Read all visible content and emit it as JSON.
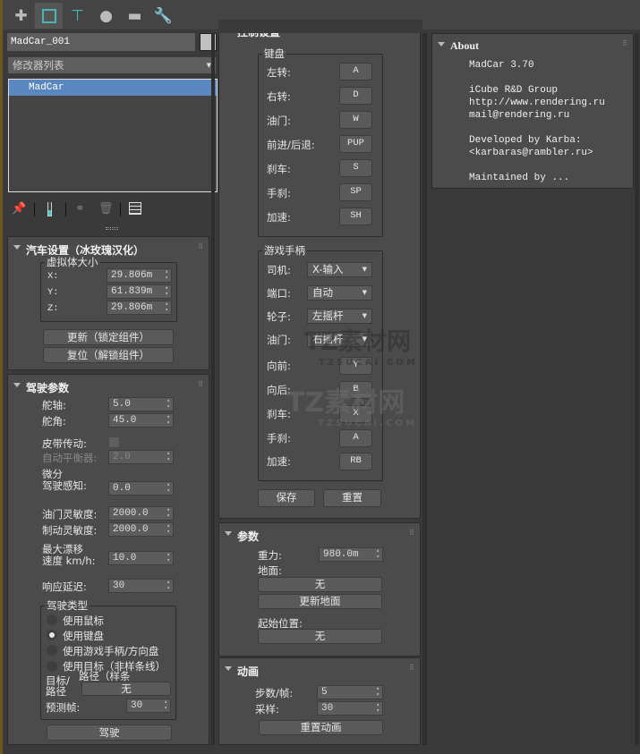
{
  "toolbar": {
    "tabs": [
      {
        "name": "create",
        "icon": "plus-icon"
      },
      {
        "name": "modify",
        "icon": "modify-icon",
        "active": true
      },
      {
        "name": "hierarchy",
        "icon": "hierarchy-icon"
      },
      {
        "name": "motion",
        "icon": "motion-icon"
      },
      {
        "name": "display",
        "icon": "display-icon"
      },
      {
        "name": "utilities",
        "icon": "wrench-icon"
      }
    ]
  },
  "object": {
    "name": "MadCar_001",
    "color": "#c0c0c0"
  },
  "modifier_list": {
    "label": "修改器列表",
    "stack": [
      "MadCar"
    ]
  },
  "car_setup": {
    "title": "汽车设置（冰玫瑰汉化）",
    "group": "虚拟体大小",
    "x_label": "X:",
    "x": "29.806m",
    "y_label": "Y:",
    "y": "61.839m",
    "z_label": "Z:",
    "z": "29.806m",
    "update": "更新（锁定组件）",
    "reset": "复位（解锁组件）"
  },
  "drive": {
    "title": "驾驶参数",
    "axle_label": "舵轴:",
    "axle": "5.0",
    "angle_label": "舵角:",
    "angle": "45.0",
    "belt_label": "皮带传动:",
    "autobal_label": "自动平衡器:",
    "autobal": "2.0",
    "diff_label1": "微分",
    "diff_label2": "驾驶感知:",
    "diff": "0.0",
    "throttle_label": "油门灵敏度:",
    "throttle": "2000.0",
    "brake_label": "制动灵敏度:",
    "brake": "2000.0",
    "drift_label1": "最大漂移",
    "drift_label2": "速度 km/h:",
    "drift": "10.0",
    "delay_label": "响应延迟:",
    "delay": "30",
    "type_group": "驾驶类型",
    "types": [
      "使用鼠标",
      "使用键盘",
      "使用游戏手柄/方向盘",
      "使用目标（非样条线）"
    ],
    "selected_type": 1,
    "target_label1": "目标/",
    "target_label2": "路径",
    "path_label": "路径（样条",
    "target_btn": "无",
    "predict_label": "预测帧:",
    "predict": "30",
    "drive_btn": "驾驶"
  },
  "control": {
    "title": "控制设置",
    "keyboard": "键盘",
    "keys": [
      {
        "label": "左转:",
        "key": "A"
      },
      {
        "label": "右转:",
        "key": "D"
      },
      {
        "label": "油门:",
        "key": "W"
      },
      {
        "label": "前进/后退:",
        "key": "PUP"
      },
      {
        "label": "刹车:",
        "key": "S"
      },
      {
        "label": "手刹:",
        "key": "SP"
      },
      {
        "label": "加速:",
        "key": "SH"
      }
    ],
    "gamepad": "游戏手柄",
    "selects": [
      {
        "label": "司机:",
        "value": "X-输入"
      },
      {
        "label": "端口:",
        "value": "自动"
      },
      {
        "label": "轮子:",
        "value": "左摇杆"
      },
      {
        "label": "油门:",
        "value": "右摇杆"
      }
    ],
    "pad_buttons": [
      {
        "label": "向前:",
        "key": "Y"
      },
      {
        "label": "向后:",
        "key": "B"
      },
      {
        "label": "刹车:",
        "key": "X"
      },
      {
        "label": "手刹:",
        "key": "A"
      },
      {
        "label": "加速:",
        "key": "RB"
      }
    ],
    "save": "保存",
    "reset": "重置"
  },
  "params": {
    "title": "参数",
    "gravity_label": "重力:",
    "gravity": "980.0m",
    "ground_label": "地面:",
    "ground_btn": "无",
    "update_ground": "更新地面",
    "start_label": "起始位置:",
    "start_btn": "无"
  },
  "anim": {
    "title": "动画",
    "steps_label": "步数/帧:",
    "steps": "5",
    "samples_label": "采样:",
    "samples": "30",
    "reset_anim": "重置动画"
  },
  "about": {
    "title": "About",
    "text": "MadCar 3.70\n\niCube R&D Group\nhttp://www.rendering.ru\nmail@rendering.ru\n\nDeveloped by Karba:\n<karbaras@rambler.ru>\n\nMaintained by ..."
  },
  "watermark": {
    "brand": "TZ素材网",
    "url": "TZSUCAI.COM"
  }
}
